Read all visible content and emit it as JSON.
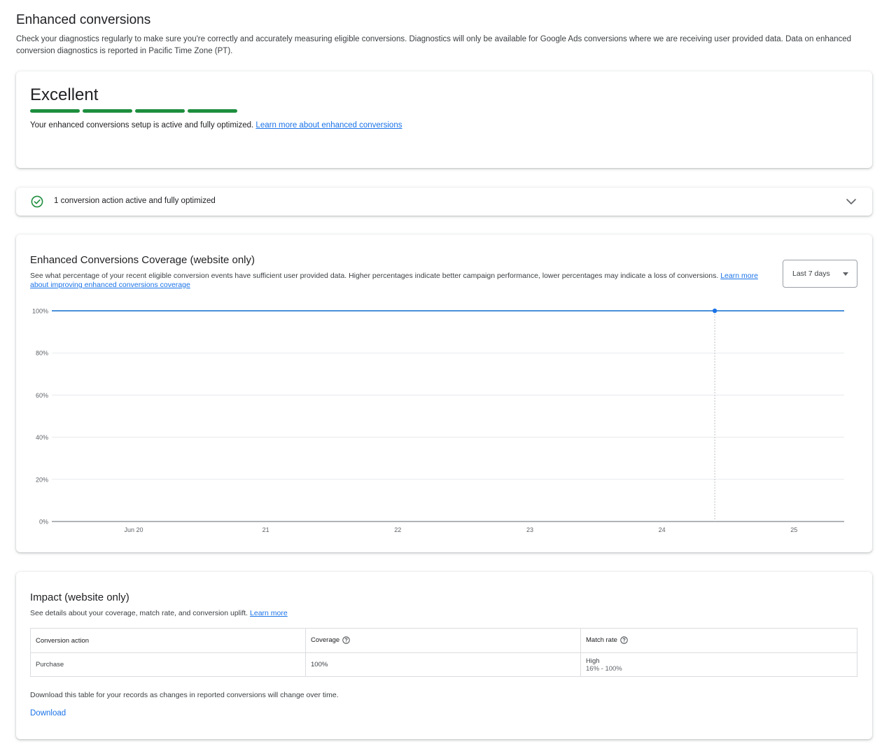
{
  "page": {
    "title": "Enhanced conversions",
    "description": "Check your diagnostics regularly to make sure you're correctly and accurately measuring eligible conversions. Diagnostics will only be available for Google Ads conversions where we are receiving user provided data. Data on enhanced conversion diagnostics is reported in Pacific Time Zone (PT)."
  },
  "status": {
    "title": "Excellent",
    "level_segments_filled": 4,
    "level_segments_total": 4,
    "text": "Your enhanced conversions setup is active and fully optimized.",
    "link": "Learn more about enhanced conversions",
    "color": "#1e8e3e"
  },
  "actions": {
    "text": "1 conversion action active and fully optimized",
    "icon": "check-circle-icon",
    "expand_icon": "chevron-down-icon"
  },
  "coverage": {
    "title": "Enhanced Conversions Coverage (website only)",
    "description": "See what percentage of your recent eligible conversion events have sufficient user provided data. Higher percentages indicate better campaign performance, lower percentages may indicate a loss of conversions.",
    "link": "Learn more about improving enhanced conversions coverage",
    "range_label": "Last 7 days"
  },
  "chart_data": {
    "type": "line",
    "y_ticks": [
      "100%",
      "80%",
      "60%",
      "40%",
      "20%",
      "0%"
    ],
    "x_ticks": [
      "Jun 20",
      "21",
      "22",
      "23",
      "24",
      "25"
    ],
    "ylim": [
      0,
      100
    ],
    "series": [
      {
        "values": [
          100,
          100,
          100,
          100,
          100,
          100,
          100
        ],
        "color": "#4a90d9"
      }
    ],
    "highlight_point": {
      "day": 24.4,
      "value": 100
    },
    "grid": true
  },
  "impact": {
    "title": "Impact (website only)",
    "description": "See details about your coverage, match rate, and conversion uplift.",
    "link": "Learn more",
    "table": {
      "headers": [
        "Conversion action",
        "Coverage",
        "Match rate"
      ],
      "rows": [
        {
          "action": "Purchase",
          "coverage": "100%",
          "match_rate": "High",
          "match_range": "16% - 100%"
        }
      ]
    },
    "note": "Download this table for your records as changes in reported conversions will change over time.",
    "download_label": "Download"
  }
}
